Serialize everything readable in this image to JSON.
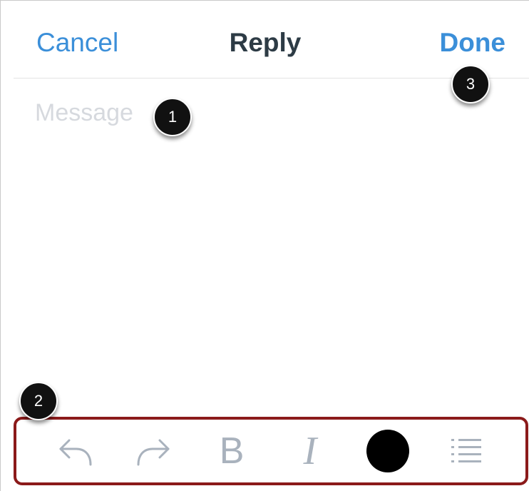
{
  "navbar": {
    "cancel_label": "Cancel",
    "title": "Reply",
    "done_label": "Done"
  },
  "message": {
    "placeholder": "Message",
    "value": ""
  },
  "toolbar": {
    "tools": [
      {
        "name": "undo",
        "icon": "undo-arrow-icon"
      },
      {
        "name": "redo",
        "icon": "redo-arrow-icon"
      },
      {
        "name": "bold",
        "label": "B",
        "icon": "bold-icon"
      },
      {
        "name": "italic",
        "label": "I",
        "icon": "italic-icon"
      },
      {
        "name": "text-color",
        "icon": "color-dot-icon",
        "color": "#000000"
      },
      {
        "name": "list",
        "icon": "bulleted-list-icon"
      }
    ],
    "highlight_color": "#8b1a1a"
  },
  "callouts": {
    "one": "1",
    "two": "2",
    "three": "3"
  },
  "colors": {
    "accent": "#3b8fd9",
    "title": "#2d3b45",
    "icon": "#a9b2bd",
    "placeholder": "#d6d9de"
  }
}
